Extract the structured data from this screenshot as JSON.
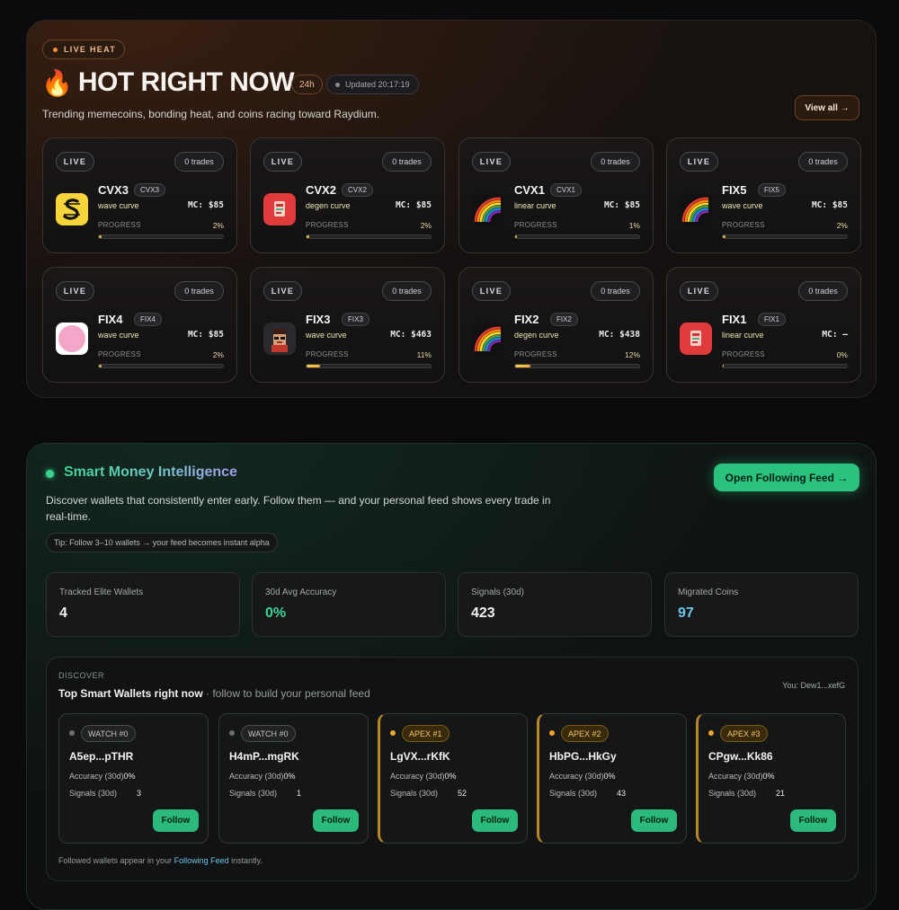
{
  "hot": {
    "badge": "LIVE HEAT",
    "flame": "🔥",
    "title": "HOT RIGHT NOW",
    "range": "24h",
    "updated": "Updated 20:17:19",
    "subtitle": "Trending memecoins, bonding heat, and coins racing toward Raydium.",
    "view_all": "View all →",
    "live_label": "LIVE",
    "progress_label": "PROGRESS",
    "coins": [
      {
        "name": "CVX3",
        "tag": "CVX3",
        "curve": "wave curve",
        "mc": "MC: $85",
        "progress": "2%",
        "progress_pct": 2,
        "trades": "0 trades",
        "icon": "s-logo-icon"
      },
      {
        "name": "CVX2",
        "tag": "CVX2",
        "curve": "degen curve",
        "mc": "MC: $85",
        "progress": "2%",
        "progress_pct": 2,
        "trades": "0 trades",
        "icon": "red-doc-icon"
      },
      {
        "name": "CVX1",
        "tag": "CVX1",
        "curve": "linear curve",
        "mc": "MC: $85",
        "progress": "1%",
        "progress_pct": 1,
        "trades": "0 trades",
        "icon": "rainbow-icon"
      },
      {
        "name": "FIX5",
        "tag": "FIX5",
        "curve": "wave curve",
        "mc": "MC: $85",
        "progress": "2%",
        "progress_pct": 2,
        "trades": "0 trades",
        "icon": "rainbow-icon"
      },
      {
        "name": "FIX4",
        "tag": "FIX4",
        "curve": "wave curve",
        "mc": "MC: $85",
        "progress": "2%",
        "progress_pct": 2,
        "trades": "0 trades",
        "icon": "pink-circle-icon"
      },
      {
        "name": "FIX3",
        "tag": "FIX3",
        "curve": "wave curve",
        "mc": "MC: $463",
        "progress": "11%",
        "progress_pct": 11,
        "trades": "0 trades",
        "icon": "pixel-face-icon"
      },
      {
        "name": "FIX2",
        "tag": "FIX2",
        "curve": "degen curve",
        "mc": "MC: $438",
        "progress": "12%",
        "progress_pct": 12,
        "trades": "0 trades",
        "icon": "rainbow-icon"
      },
      {
        "name": "FIX1",
        "tag": "FIX1",
        "curve": "linear curve",
        "mc": "MC: —",
        "progress": "0%",
        "progress_pct": 0,
        "trades": "0 trades",
        "icon": "red-doc-icon"
      }
    ]
  },
  "smart": {
    "title": "Smart Money Intelligence",
    "description": "Discover wallets that consistently enter early. Follow them — and your personal feed shows every trade in real-time.",
    "tip": "Tip: Follow 3–10 wallets → your feed becomes instant alpha",
    "open_feed": "Open Following Feed →",
    "stats": [
      {
        "label": "Tracked Elite Wallets",
        "value": "4",
        "color": "#f1f1f3"
      },
      {
        "label": "30d Avg Accuracy",
        "value": "0%",
        "color": "#3fd49a"
      },
      {
        "label": "Signals (30d)",
        "value": "423",
        "color": "#f1f1f3"
      },
      {
        "label": "Migrated Coins",
        "value": "97",
        "color": "#6ec4e8"
      }
    ],
    "discover": {
      "kicker": "DISCOVER",
      "title": "Top Smart Wallets right now",
      "title_sub": " · follow to build your personal feed",
      "you": "You: Dew1...xefG",
      "foot_text": "Followed wallets appear in your ",
      "foot_link": "Following Feed",
      "foot_tail": " instantly.",
      "accuracy_label": "Accuracy (30d)",
      "signals_label": "Signals (30d)",
      "follow_label": "Follow",
      "wallets": [
        {
          "badge": "WATCH #0",
          "name": "A5ep...pTHR",
          "accuracy": "0%",
          "signals": "3",
          "apex": false
        },
        {
          "badge": "WATCH #0",
          "name": "H4mP...mgRK",
          "accuracy": "0%",
          "signals": "1",
          "apex": false
        },
        {
          "badge": "APEX #1",
          "name": "LgVX...rKfK",
          "accuracy": "0%",
          "signals": "52",
          "apex": true
        },
        {
          "badge": "APEX #2",
          "name": "HbPG...HkGy",
          "accuracy": "0%",
          "signals": "43",
          "apex": true
        },
        {
          "badge": "APEX #3",
          "name": "CPgw...Kk86",
          "accuracy": "0%",
          "signals": "21",
          "apex": true
        }
      ]
    }
  }
}
